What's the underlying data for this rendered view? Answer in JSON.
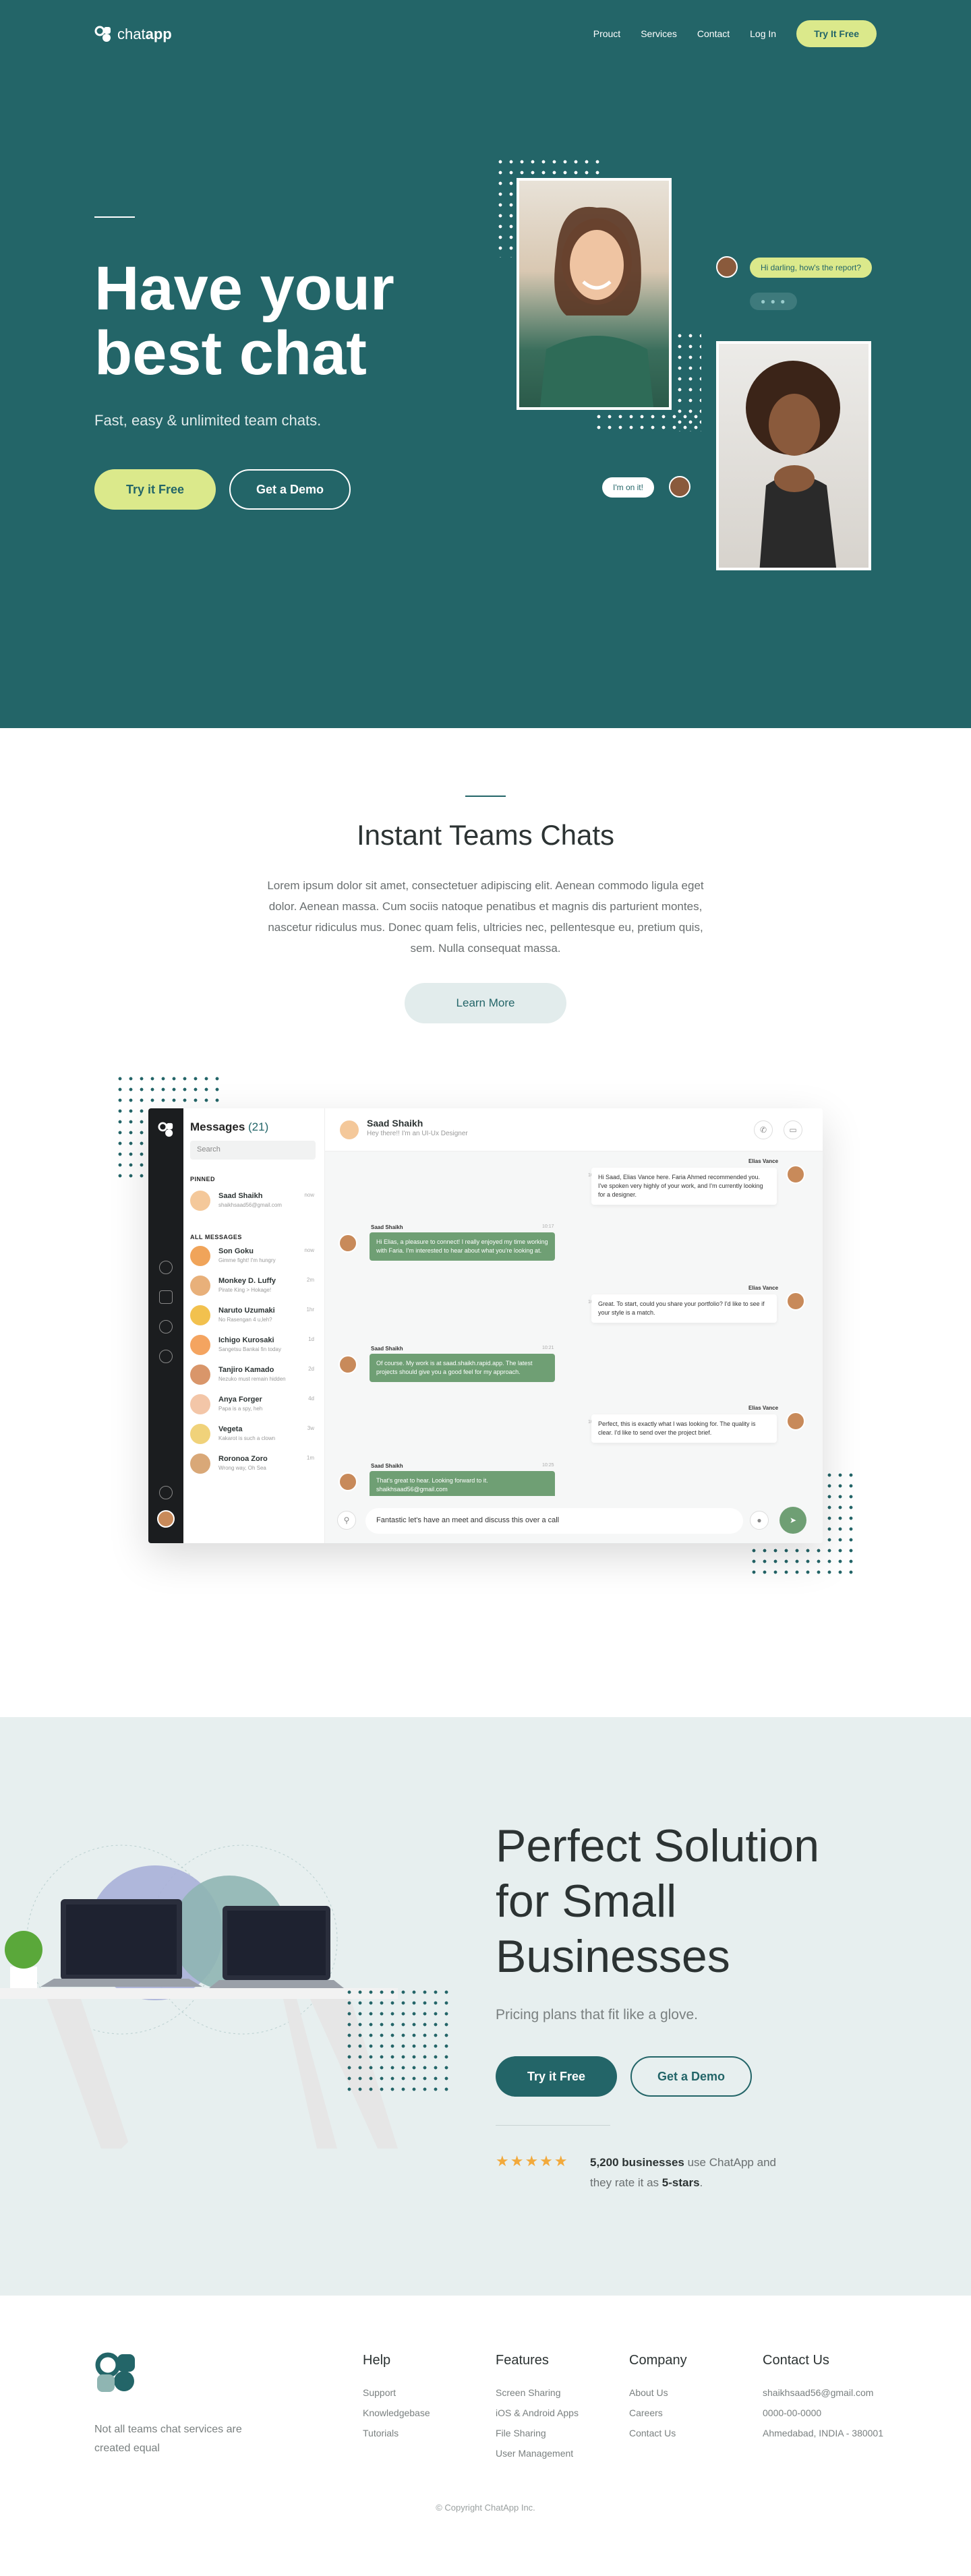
{
  "brand": {
    "name_light": "chat",
    "name_bold": "app"
  },
  "nav": {
    "items": [
      "Prouct",
      "Services",
      "Contact",
      "Log In"
    ],
    "cta": "Try It Free"
  },
  "hero": {
    "title_line1": "Have your",
    "title_line2": "best chat",
    "subtitle": "Fast, easy & unlimited team chats.",
    "primary": "Try it Free",
    "secondary": "Get a Demo",
    "bubble_top": "Hi darling, how's the report?",
    "bubble_bottom": "I'm on it!"
  },
  "features": {
    "title": "Instant Teams Chats",
    "body": "Lorem ipsum dolor sit amet, consectetuer adipiscing elit. Aenean commodo ligula eget dolor. Aenean massa. Cum sociis natoque penatibus et magnis dis parturient montes, nascetur ridiculus mus. Donec quam felis, ultricies nec, pellentesque eu, pretium quis, sem. Nulla consequat massa.",
    "cta": "Learn More"
  },
  "app": {
    "messages_label": "Messages",
    "messages_count": "(21)",
    "search_placeholder": "Search",
    "pinned_label": "PINNED",
    "all_label": "ALL MESSAGES",
    "pinned": {
      "name": "Saad Shaikh",
      "msg": "shaikhsaad56@gmail.com",
      "time": "now"
    },
    "contacts": [
      {
        "name": "Son Goku",
        "msg": "Gimme fight! I'm hungry",
        "time": "now"
      },
      {
        "name": "Monkey D. Luffy",
        "msg": "Pirate King > Hokage!",
        "time": "2m"
      },
      {
        "name": "Naruto Uzumaki",
        "msg": "No Rasengan 4 u,leh?",
        "time": "1hr"
      },
      {
        "name": "Ichigo Kurosaki",
        "msg": "Sangetsu Bankai fin today",
        "time": "1d"
      },
      {
        "name": "Tanjiro Kamado",
        "msg": "Nezuko must remain hidden",
        "time": "2d"
      },
      {
        "name": "Anya Forger",
        "msg": "Papa is a spy, heh",
        "time": "4d"
      },
      {
        "name": "Vegeta",
        "msg": "Kakarot is such a clown",
        "time": "3w"
      },
      {
        "name": "Roronoa Zoro",
        "msg": "Wrong way, Oh Sea",
        "time": "1m"
      }
    ],
    "chat_name": "Saad Shaikh",
    "chat_status": "Hey there!! I'm an UI-Ux Designer",
    "conversation": [
      {
        "dir": "out",
        "who": "Elias Vance",
        "time": "10:15",
        "text": "Hi Saad, Elias Vance here. Faria Ahmed recommended you. I've spoken very highly of your work, and I'm currently looking for a designer."
      },
      {
        "dir": "in",
        "who": "Saad Shaikh",
        "time": "10:17",
        "text": "Hi Elias, a pleasure to connect! I really enjoyed my time working with Faria. I'm interested to hear about what you're looking at."
      },
      {
        "dir": "out",
        "who": "Elias Vance",
        "time": "10:19",
        "text": "Great. To start, could you share your portfolio? I'd like to see if your style is a match."
      },
      {
        "dir": "in",
        "who": "Saad Shaikh",
        "time": "10:21",
        "text": "Of course. My work is at saad.shaikh.rapid.app. The latest projects should give you a good feel for my approach."
      },
      {
        "dir": "out",
        "who": "Elias Vance",
        "time": "10:24",
        "text": "Perfect, this is exactly what I was looking for. The quality is clear. I'd like to send over the project brief."
      },
      {
        "dir": "in",
        "who": "Saad Shaikh",
        "time": "10:25",
        "text": "That's great to hear. Looking forward to it. shaikhsaad56@gmail.com"
      },
      {
        "dir": "out",
        "who": "Elias Vance",
        "time": "",
        "text": "• • •"
      }
    ],
    "composer": "Fantastic let's have an meet and discuss this over a call"
  },
  "solution": {
    "title_l1": "Perfect Solution",
    "title_l2": "for Small",
    "title_l3": "Businesses",
    "subtitle": "Pricing plans that fit like a glove.",
    "primary": "Try it Free",
    "secondary": "Get a Demo",
    "stars": "★★★★★",
    "rate_count": "5,200 businesses",
    "rate_mid": " use ChatApp and they rate it as ",
    "rate_end": "5-stars",
    "rate_dot": "."
  },
  "footer": {
    "tagline": "Not all teams chat services are created equal",
    "columns": [
      {
        "title": "Help",
        "links": [
          "Support",
          "Knowledgebase",
          "Tutorials"
        ]
      },
      {
        "title": "Features",
        "links": [
          "Screen Sharing",
          "iOS & Android Apps",
          "File Sharing",
          "User Management"
        ]
      },
      {
        "title": "Company",
        "links": [
          "About Us",
          "Careers",
          "Contact Us"
        ]
      },
      {
        "title": "Contact Us",
        "links": [
          "shaikhsaad56@gmail.com",
          "0000-00-0000",
          "Ahmedabad, INDIA - 380001"
        ]
      }
    ],
    "copyright": "© Copyright ChatApp Inc."
  },
  "colors": {
    "primary": "#236568",
    "accent": "#dbe98b",
    "light": "#e7efef",
    "star": "#f2a93b",
    "chat_in": "#6f9f74"
  }
}
